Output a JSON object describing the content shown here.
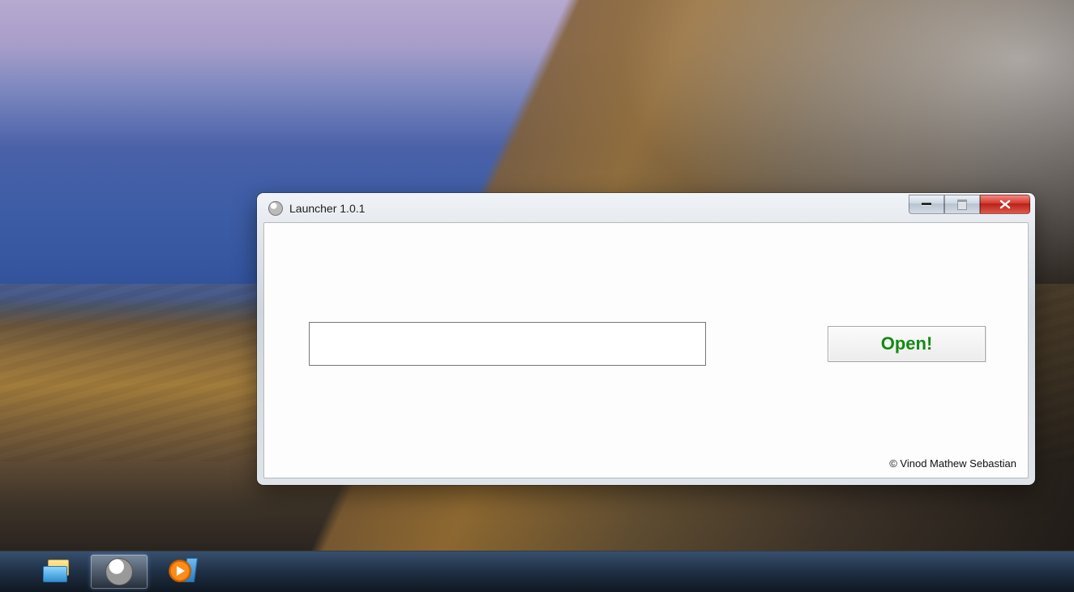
{
  "window": {
    "title": "Launcher 1.0.1",
    "input_value": "",
    "open_label": "Open!",
    "copyright": "© Vinod Mathew Sebastian"
  },
  "taskbar": {
    "items": [
      {
        "name": "file-explorer",
        "active": false
      },
      {
        "name": "launcher-app",
        "active": true
      },
      {
        "name": "media-player",
        "active": false
      }
    ]
  }
}
